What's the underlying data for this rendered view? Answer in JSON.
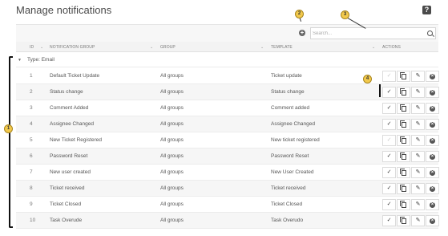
{
  "page": {
    "title": "Manage notifications",
    "help_icon": "?"
  },
  "toolbar": {
    "add_icon": "+",
    "search_placeholder": "Search..."
  },
  "columns": {
    "id": "ID",
    "notification_group": "NOTIFICATION GROUP",
    "group": "GROUP",
    "template": "TEMPLATE",
    "actions": "ACTIONS"
  },
  "group_row": {
    "label": "Type: Email"
  },
  "rows": [
    {
      "id": "1",
      "name": "Default Ticket Update",
      "group": "All groups",
      "template": "Ticket update",
      "check_disabled": true
    },
    {
      "id": "2",
      "name": "Status change",
      "group": "All groups",
      "template": "Status change",
      "check_disabled": false
    },
    {
      "id": "3",
      "name": "Comment Added",
      "group": "All groups",
      "template": "Comment added",
      "check_disabled": false
    },
    {
      "id": "4",
      "name": "Assignee Changed",
      "group": "All groups",
      "template": "Assignee Changed",
      "check_disabled": false
    },
    {
      "id": "5",
      "name": "New Ticket Registered",
      "group": "All groups",
      "template": "New ticket registered",
      "check_disabled": true
    },
    {
      "id": "6",
      "name": "Password Reset",
      "group": "All groups",
      "template": "Password Reset",
      "check_disabled": false
    },
    {
      "id": "7",
      "name": "New user created",
      "group": "All groups",
      "template": "New User Created",
      "check_disabled": false
    },
    {
      "id": "8",
      "name": "Ticket received",
      "group": "All groups",
      "template": "Ticket received",
      "check_disabled": false
    },
    {
      "id": "9",
      "name": "Ticket Closed",
      "group": "All groups",
      "template": "Ticket Closed",
      "check_disabled": false
    },
    {
      "id": "10",
      "name": "Task Overude",
      "group": "All groups",
      "template": "Task Overudo",
      "check_disabled": false
    }
  ],
  "action_icons": {
    "check": "✓",
    "copy": "copy-icon",
    "edit": "✎",
    "delete": "×"
  },
  "callouts": [
    "1",
    "2",
    "3",
    "4"
  ],
  "colors": {
    "callout_fill": "#f2c94c",
    "header_bg": "#f3f3f3",
    "alt_row_bg": "#f6f6f6"
  }
}
